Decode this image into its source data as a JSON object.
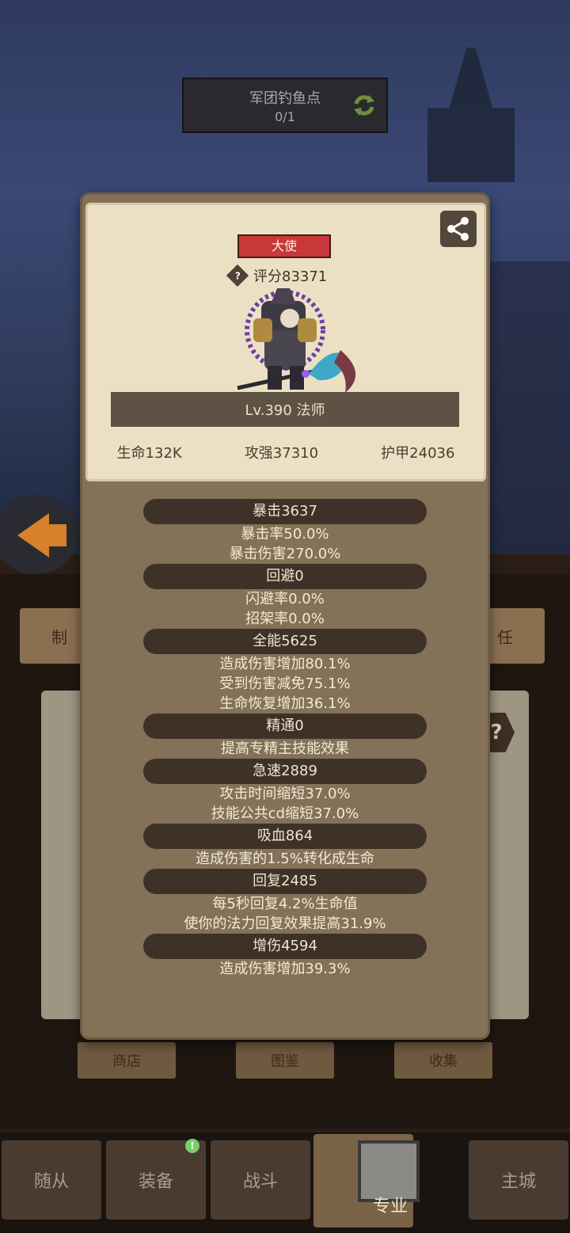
{
  "banner": {
    "title": "军团钓鱼点",
    "count": "0/1"
  },
  "background_buttons": {
    "tab_left": "制",
    "tab_right": "任",
    "shop": "商店",
    "codex": "图鉴",
    "collect": "收集"
  },
  "profile": {
    "title_badge": "大使",
    "score": "评分83371",
    "level_class": "Lv.390 法师",
    "hp": "生命132K",
    "attack": "攻强37310",
    "armor": "护甲24036"
  },
  "stats": [
    {
      "name": "暴击3637",
      "details": [
        "暴击率50.0%",
        "暴击伤害270.0%"
      ]
    },
    {
      "name": "回避0",
      "details": [
        "闪避率0.0%",
        "招架率0.0%"
      ]
    },
    {
      "name": "全能5625",
      "details": [
        "造成伤害增加80.1%",
        "受到伤害减免75.1%",
        "生命恢复增加36.1%"
      ]
    },
    {
      "name": "精通0",
      "details": [
        "提高专精主技能效果"
      ]
    },
    {
      "name": "急速2889",
      "details": [
        "攻击时间缩短37.0%",
        "技能公共cd缩短37.0%"
      ]
    },
    {
      "name": "吸血864",
      "details": [
        "造成伤害的1.5%转化成生命"
      ]
    },
    {
      "name": "回复2485",
      "details": [
        "每5秒回复4.2%生命值",
        "使你的法力回复效果提高31.9%"
      ]
    },
    {
      "name": "增伤4594",
      "details": [
        "造成伤害增加39.3%"
      ]
    }
  ],
  "nav": {
    "items": [
      "随从",
      "装备",
      "战斗",
      "专业",
      "主城"
    ],
    "active": "专业",
    "badge": "!"
  },
  "icons": {
    "help": "?",
    "share": "share-icon",
    "refresh": "refresh-icon"
  }
}
